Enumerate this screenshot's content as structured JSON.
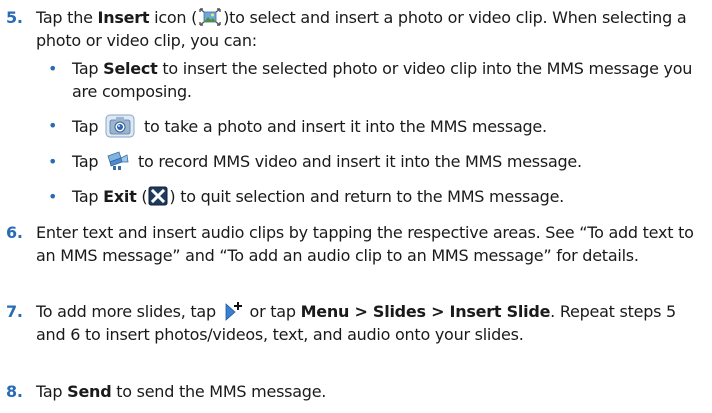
{
  "steps": [
    {
      "num": "5.",
      "a": "Tap the ",
      "b1": "Insert",
      "c": " icon (",
      "insert_icon": "insert-media-icon",
      "d": ")to select and insert a photo or video clip. When selecting a photo or video clip, you can:"
    },
    {
      "num": "6.",
      "text": "Enter text and insert audio clips by tapping the respective areas. See “To add text to an MMS message” and “To add an audio clip to an MMS message” for details."
    },
    {
      "num": "7.",
      "a": "To add more slides, tap ",
      "slide_icon": "add-slide-icon",
      "b": " or tap ",
      "bold": "Menu > Slides > Insert Slide",
      "c": ". Repeat steps 5 and 6 to insert photos/videos, text, and audio onto your slides."
    },
    {
      "num": "8.",
      "a": "Tap ",
      "bold": "Send",
      "b": " to send the MMS message."
    }
  ],
  "bullets": [
    {
      "a": "Tap ",
      "bold": "Select",
      "b": " to insert the selected photo or video clip into the MMS message you are composing."
    },
    {
      "a": "Tap ",
      "icon": "camera-icon",
      "b": " to take a photo and insert it into the MMS message."
    },
    {
      "a": "Tap ",
      "icon": "video-camera-icon",
      "b": " to record MMS video and insert it into the MMS message."
    },
    {
      "a": "Tap ",
      "bold": "Exit",
      "b": " (",
      "icon": "exit-icon",
      "c": ") to quit selection and return to the MMS message."
    }
  ],
  "bullet_char": "•",
  "colors": {
    "accent": "#2a6bb6",
    "text": "#1a1a1a"
  }
}
